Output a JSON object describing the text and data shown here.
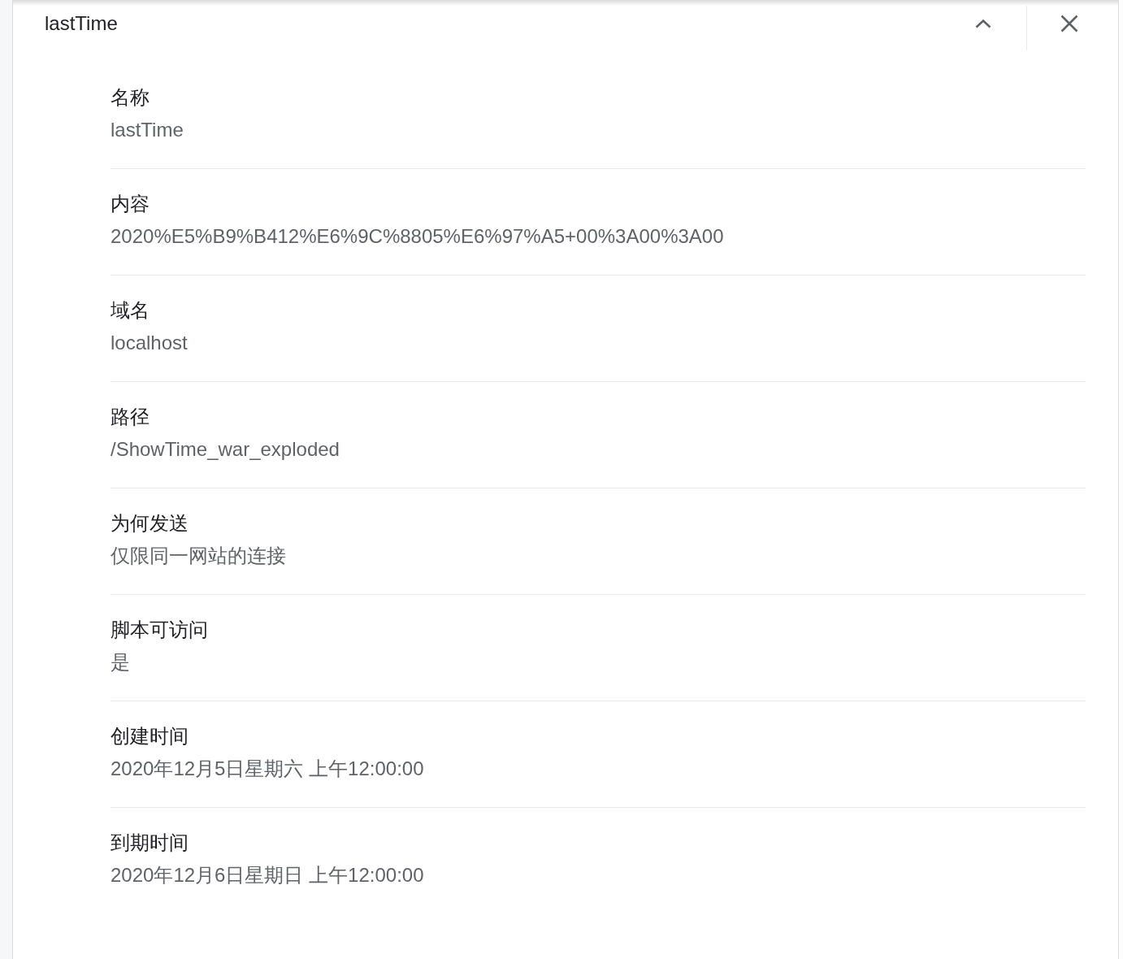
{
  "header": {
    "title": "lastTime"
  },
  "fields": [
    {
      "label": "名称",
      "value": "lastTime"
    },
    {
      "label": "内容",
      "value": "2020%E5%B9%B412%E6%9C%8805%E6%97%A5+00%3A00%3A00"
    },
    {
      "label": "域名",
      "value": "localhost"
    },
    {
      "label": "路径",
      "value": "/ShowTime_war_exploded"
    },
    {
      "label": "为何发送",
      "value": "仅限同一网站的连接"
    },
    {
      "label": "脚本可访问",
      "value": "是"
    },
    {
      "label": "创建时间",
      "value": "2020年12月5日星期六 上午12:00:00"
    },
    {
      "label": "到期时间",
      "value": "2020年12月6日星期日 上午12:00:00"
    }
  ]
}
